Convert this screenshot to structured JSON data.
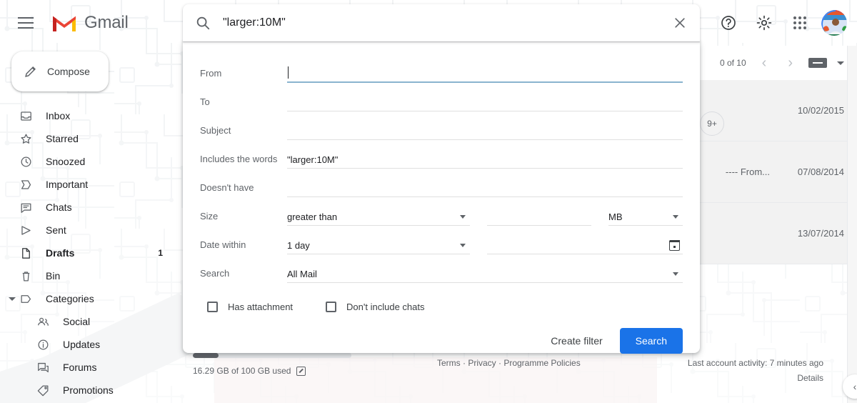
{
  "header": {
    "menu_icon": "hamburger-icon",
    "brand": "Gmail",
    "help_icon": "help-icon",
    "settings_icon": "gear-icon",
    "apps_icon": "apps-grid-icon",
    "avatar_icon": "account-avatar"
  },
  "sidebar": {
    "compose": "Compose",
    "items": [
      {
        "label": "Inbox",
        "icon": "inbox-icon",
        "count": "",
        "bold": false,
        "sub": false
      },
      {
        "label": "Starred",
        "icon": "star-icon",
        "count": "",
        "bold": false,
        "sub": false
      },
      {
        "label": "Snoozed",
        "icon": "clock-icon",
        "count": "",
        "bold": false,
        "sub": false
      },
      {
        "label": "Important",
        "icon": "label-important-icon",
        "count": "",
        "bold": false,
        "sub": false
      },
      {
        "label": "Chats",
        "icon": "chat-icon",
        "count": "",
        "bold": false,
        "sub": false
      },
      {
        "label": "Sent",
        "icon": "send-icon",
        "count": "",
        "bold": false,
        "sub": false
      },
      {
        "label": "Drafts",
        "icon": "draft-icon",
        "count": "1",
        "bold": true,
        "sub": false
      },
      {
        "label": "Bin",
        "icon": "trash-icon",
        "count": "",
        "bold": false,
        "sub": false
      },
      {
        "label": "Categories",
        "icon": "label-icon",
        "count": "",
        "bold": false,
        "sub": false,
        "expandable": true
      },
      {
        "label": "Social",
        "icon": "people-icon",
        "count": "",
        "bold": false,
        "sub": true
      },
      {
        "label": "Updates",
        "icon": "info-icon",
        "count": "",
        "bold": false,
        "sub": true
      },
      {
        "label": "Forums",
        "icon": "forum-icon",
        "count": "",
        "bold": false,
        "sub": true
      },
      {
        "label": "Promotions",
        "icon": "tag-icon",
        "count": "",
        "bold": false,
        "sub": true
      }
    ]
  },
  "search": {
    "icon": "search-icon",
    "value": "\"larger:10M\"",
    "close_icon": "close-icon"
  },
  "advanced_search": {
    "fields": [
      {
        "label": "From",
        "value": "",
        "focused": true
      },
      {
        "label": "To",
        "value": "",
        "focused": false
      },
      {
        "label": "Subject",
        "value": "",
        "focused": false
      },
      {
        "label": "Includes the words",
        "value": "\"larger:10M\"",
        "focused": false
      },
      {
        "label": "Doesn't have",
        "value": "",
        "focused": false
      }
    ],
    "size": {
      "label": "Size",
      "operator": "greater than",
      "amount": "",
      "unit": "MB"
    },
    "date": {
      "label": "Date within",
      "range": "1 day",
      "value": "",
      "calendar_icon": "calendar-icon"
    },
    "scope": {
      "label": "Search",
      "value": "All Mail"
    },
    "checkboxes": [
      {
        "label": "Has attachment",
        "checked": false
      },
      {
        "label": "Don't include chats",
        "checked": false
      }
    ],
    "create_filter_label": "Create filter",
    "search_label": "Search",
    "accent_color": "#1a73e8"
  },
  "list_toolbar": {
    "pager": "0 of 10",
    "prev_icon": "chevron-left-icon",
    "next_icon": "chevron-right-icon",
    "input_tool_icon": "keyboard-icon",
    "caret_icon": "chevron-down-icon"
  },
  "mail_rows": [
    {
      "snippet": "",
      "date": "10/02/2015",
      "badge": "9+"
    },
    {
      "snippet": "---- From...",
      "date": "07/08/2014",
      "badge": ""
    },
    {
      "snippet": "",
      "date": "13/07/2014",
      "badge": ""
    }
  ],
  "footer": {
    "storage_used_text": "16.29 GB of 100 GB used",
    "storage_percent": 16,
    "external_link_icon": "open-in-new-icon",
    "legal": "Terms · Privacy · Programme Policies",
    "activity": "Last account activity: 7 minutes ago",
    "details": "Details",
    "collapse_icon": "chevron-left-icon"
  }
}
